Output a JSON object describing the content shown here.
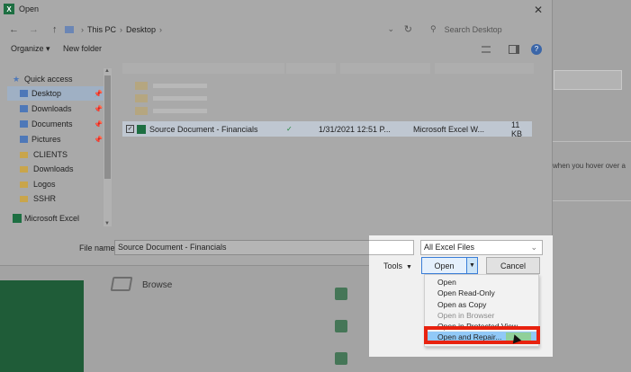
{
  "window": {
    "title": "Open",
    "close_glyph": "✕"
  },
  "address": {
    "back": "←",
    "forward": "→",
    "up": "↑",
    "crumbs": [
      "This PC",
      "Desktop"
    ],
    "search_placeholder": "Search Desktop"
  },
  "toolbar": {
    "organize": "Organize ▾",
    "new_folder": "New folder"
  },
  "nav": {
    "quick_access": "Quick access",
    "items": [
      "Desktop",
      "Downloads",
      "Documents",
      "Pictures",
      "CLIENTS",
      "Downloads",
      "Logos",
      "SSHR"
    ],
    "excel": "Microsoft Excel"
  },
  "files": {
    "selected": {
      "name": "Source Document - Financials",
      "date": "1/31/2021 12:51 P...",
      "type": "Microsoft Excel W...",
      "size": "11 KB"
    }
  },
  "filename": {
    "label": "File name:",
    "value": "Source Document - Financials"
  },
  "filetype": {
    "value": "All Excel Files"
  },
  "buttons": {
    "tools": "Tools",
    "open": "Open",
    "cancel": "Cancel"
  },
  "open_menu": {
    "items": [
      {
        "label": "Open",
        "disabled": false
      },
      {
        "label": "Open Read-Only",
        "disabled": false
      },
      {
        "label": "Open as Copy",
        "disabled": false
      },
      {
        "label": "Open in Browser",
        "disabled": true
      },
      {
        "label": "Open in Protected View",
        "disabled": false
      },
      {
        "label": "Open and Repair...",
        "disabled": false,
        "highlighted": true
      }
    ]
  },
  "background": {
    "browse": "Browse",
    "hint": "when you hover over a"
  },
  "colors": {
    "excel_green": "#1d6f42",
    "highlight": "#e8220f",
    "menu_hover": "#91c9f7"
  }
}
